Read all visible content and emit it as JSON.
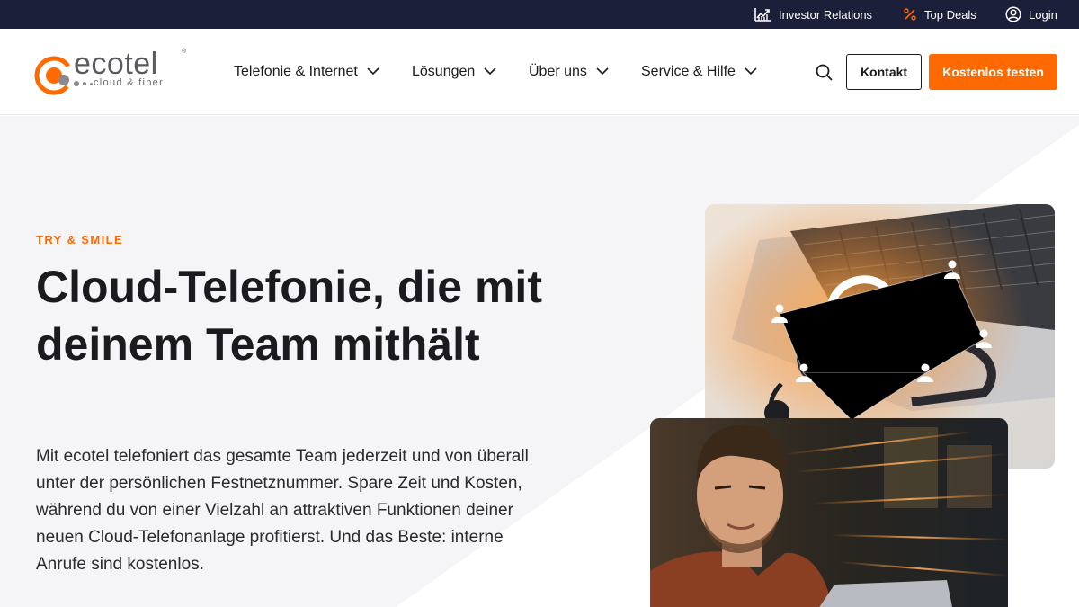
{
  "topbar": {
    "investor_relations": "Investor Relations",
    "top_deals": "Top Deals",
    "login": "Login"
  },
  "logo": {
    "word": "ecotel",
    "tagline": "cloud & fiber",
    "registered": "®"
  },
  "nav": {
    "items": [
      {
        "label": "Telefonie & Internet"
      },
      {
        "label": "Lösungen"
      },
      {
        "label": "Über uns"
      },
      {
        "label": "Service & Hilfe"
      }
    ]
  },
  "header": {
    "kontakt_label": "Kontakt",
    "trial_label": "Kostenlos testen"
  },
  "hero": {
    "eyebrow": "TRY & SMILE",
    "headline": "Cloud-Telefonie, die mit deinem Team mithält",
    "lead": "Mit ecotel telefoniert das gesamte Team jederzeit und von überall unter der persönlichen Festnetznummer. Spare Zeit und Kosten, während du von einer Vielzahl an attraktiven Funktionen deiner neuen Cloud-Telefonanlage profitierst. Und das Beste: interne Anrufe sind kostenlos."
  },
  "colors": {
    "topbar": "#1c1f3a",
    "accent": "#ff6a00",
    "hero_bg": "#f5f5f8",
    "text": "#1b1b1f"
  },
  "icons": {
    "investor": "chart-trend-icon",
    "deals": "percent-icon",
    "login": "user-circle-icon",
    "search": "search-icon",
    "dropdown": "chevron-down-icon"
  }
}
